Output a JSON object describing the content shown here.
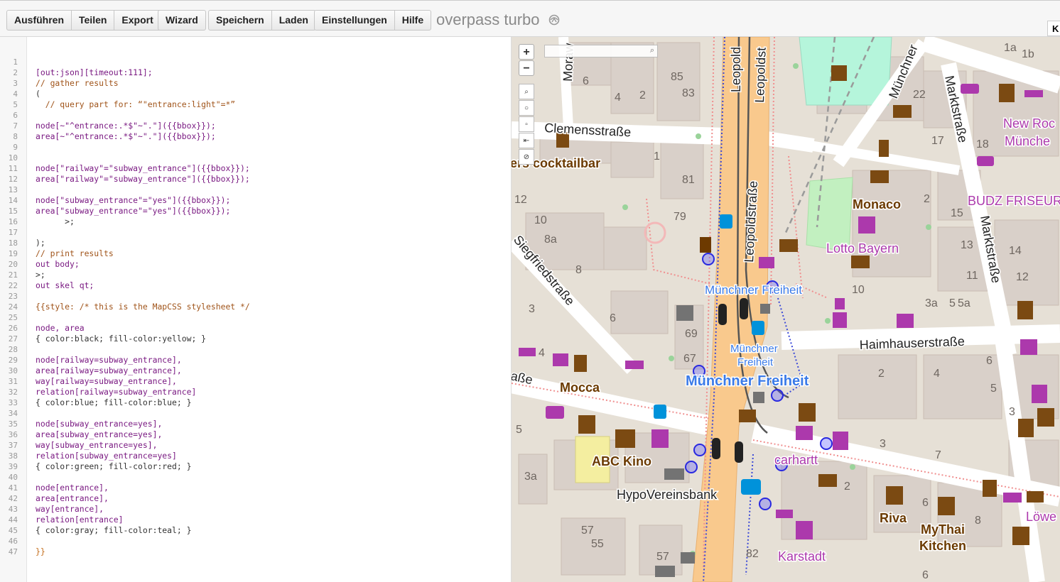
{
  "toolbar": {
    "run": "Ausführen",
    "share": "Teilen",
    "export": "Export",
    "wizard": "Wizard",
    "save": "Speichern",
    "load": "Laden",
    "settings": "Einstellungen",
    "help": "Hilfe",
    "brand": "overpass turbo",
    "corner": "K"
  },
  "editor": {
    "line_numbers": [
      "1",
      "2",
      "3",
      "4",
      "5",
      "6",
      "7",
      "8",
      "9",
      "10",
      "11",
      "12",
      "13",
      "14",
      "15",
      "16",
      "17",
      "18",
      "19",
      "20",
      "21",
      "22",
      "23",
      "24",
      "25",
      "26",
      "27",
      "28",
      "29",
      "30",
      "31",
      "32",
      "33",
      "34",
      "35",
      "36",
      "37",
      "38",
      "39",
      "40",
      "41",
      "42",
      "43",
      "44",
      "45",
      "46",
      "47"
    ],
    "lines": [
      "",
      "[out:json][timeout:111];",
      "// gather results",
      "(",
      "  // query part for: “\"entrance:light\"=*”",
      "",
      "node[~\"^entrance:.*$\"~\".\"]({{bbox}});",
      "area[~\"^entrance:.*$\"~\".\"]({{bbox}});",
      "",
      "",
      "node[\"railway\"=\"subway_entrance\"]({{bbox}});",
      "area[\"railway\"=\"subway_entrance\"]({{bbox}});",
      "",
      "node[\"subway_entrance\"=\"yes\"]({{bbox}});",
      "area[\"subway_entrance\"=\"yes\"]({{bbox}});",
      "      >;",
      "",
      ");",
      "// print results",
      "out body;",
      ">;",
      "out skel qt;",
      "",
      "{{style: /* this is the MapCSS stylesheet */",
      "",
      "node, area",
      "{ color:black; fill-color:yellow; }",
      "",
      "node[railway=subway_entrance],",
      "area[railway=subway_entrance],",
      "way[railway=subway_entrance],",
      "relation[railway=subway_entrance]",
      "{ color:blue; fill-color:blue; }",
      "",
      "node[subway_entrance=yes],",
      "area[subway_entrance=yes],",
      "way[subway_entrance=yes],",
      "relation[subway_entrance=yes]",
      "{ color:green; fill-color:red; }",
      "",
      "node[entrance],",
      "area[entrance],",
      "way[entrance],",
      "relation[entrance]",
      "{ color:gray; fill-color:teal; }",
      "",
      "}}"
    ]
  },
  "map": {
    "zoom_in": "+",
    "zoom_out": "−",
    "street_labels": {
      "clemens": "Clemensstraße",
      "leopold1": "Leopoldstraße",
      "leopold2": "Leopoldst",
      "leopold_top": "Leopold",
      "siegfried": "Siegfriedstraße",
      "haimhauser": "Haimhauserstraße",
      "markt1": "Marktstraße",
      "markt2": "Marktstraße",
      "muenchner_top": "Münchner",
      "strasse_left": "aße",
      "mora": "Moraw"
    },
    "poi_labels": {
      "cocktailbar": "ers cocktailbar",
      "monaco": "Monaco",
      "lotto": "Lotto Bayern",
      "mf1": "Münchner Freiheit",
      "mf2a": "Münchner",
      "mf2b": "Freiheit",
      "mf3": "Münchner Freiheit",
      "budz": "BUDZ FRISEUR",
      "newrock1": "New Roc",
      "newrock2": "Münche",
      "mocca": "Mocca",
      "abc": "ABC Kino",
      "hypo": "HypoVereinsbank",
      "carhartt": "carhartt",
      "riva": "Riva",
      "mythai1": "MyThai",
      "mythai2": "Kitchen",
      "karstadt": "Karstadt",
      "loewe": "Löwe"
    },
    "house_numbers": [
      "85",
      "83",
      "6",
      "4",
      "2",
      "1",
      "81",
      "79",
      "12",
      "10",
      "8a",
      "8",
      "3",
      "6",
      "69",
      "67",
      "4",
      "5",
      "3a",
      "57",
      "55",
      "57",
      "82",
      "1a",
      "1b",
      "22",
      "17",
      "18",
      "2",
      "15",
      "13",
      "14",
      "11",
      "12",
      "10",
      "3a",
      "5",
      "5a",
      "2",
      "4",
      "6",
      "5",
      "3",
      "3",
      "7",
      "2",
      "6",
      "8",
      "6"
    ]
  }
}
